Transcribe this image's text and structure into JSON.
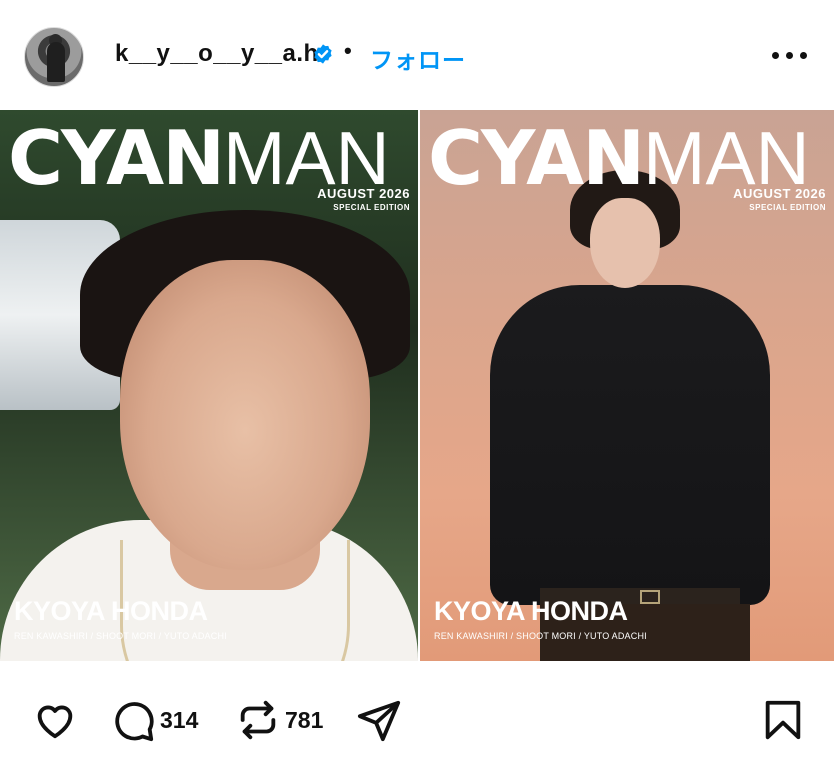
{
  "post": {
    "username": "k__y__o__y__a.h",
    "separator": "•",
    "follow_label": "フォロー",
    "icons": {
      "avatar": "profile-photo",
      "verified": "verified-badge-icon",
      "more": "more-options-icon"
    }
  },
  "covers": [
    {
      "title_bold": "CYAN",
      "title_light": "MAN",
      "issue_date": "AUGUST 2026",
      "edition": "SPECIAL EDITION",
      "cover_name": "KYOYA HONDA",
      "credits": "REN KAWASHIRI / SHOOT MORI / YUTO ADACHI"
    },
    {
      "title_bold": "CYAN",
      "title_light": "MAN",
      "issue_date": "AUGUST 2026",
      "edition": "SPECIAL EDITION",
      "cover_name": "KYOYA HONDA",
      "credits": "REN KAWASHIRI / SHOOT MORI / YUTO ADACHI"
    }
  ],
  "actions": {
    "like_icon": "heart-icon",
    "comment_icon": "comment-icon",
    "comment_count": "314",
    "repost_icon": "repost-icon",
    "repost_count": "781",
    "share_icon": "send-icon",
    "save_icon": "bookmark-icon"
  },
  "colors": {
    "accent": "#0095f6",
    "verified": "#0095f6",
    "text": "#111111"
  }
}
